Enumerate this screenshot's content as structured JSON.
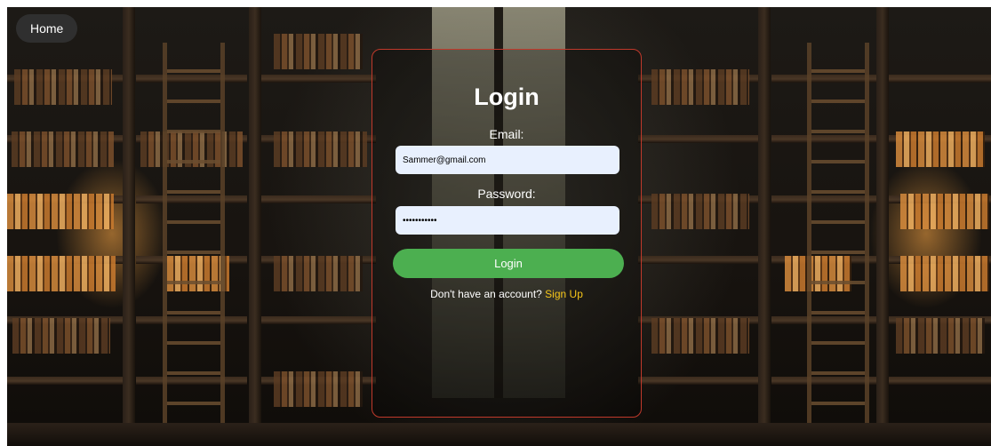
{
  "nav": {
    "home_label": "Home"
  },
  "login": {
    "title": "Login",
    "email_label": "Email:",
    "email_value": "Sammer@gmail.com",
    "password_label": "Password:",
    "password_value": "sammer12345",
    "submit_label": "Login",
    "signup_prompt": "Don't have an account?",
    "signup_link": "Sign Up"
  },
  "colors": {
    "card_border": "#c0392b",
    "submit_button": "#4caf50",
    "signup_link": "#f5c518",
    "input_background": "#e8f0fe",
    "home_button": "#2f2f2f"
  }
}
